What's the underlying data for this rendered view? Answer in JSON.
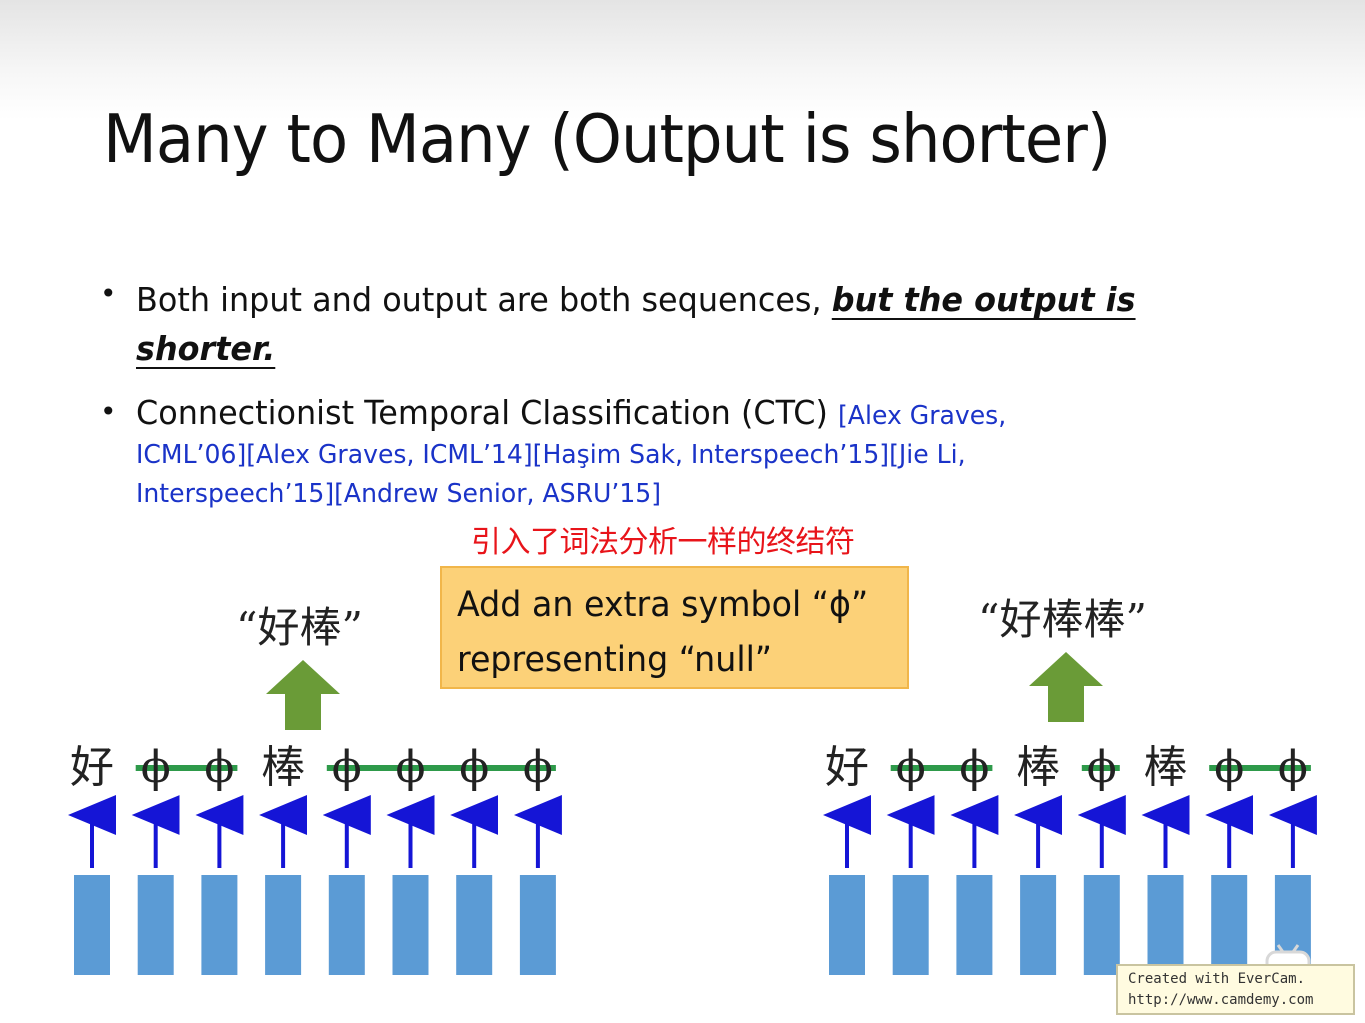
{
  "slide": {
    "title": "Many to Many (Output is shorter)",
    "bullets": [
      {
        "text_plain": "Both input and output are both sequences, ",
        "text_emphasis": "but the output is shorter."
      },
      {
        "text_plain": "Connectionist Temporal Classification (CTC) ",
        "refs_lines": [
          "[Alex Graves,",
          "ICML’06][Alex Graves, ICML’14][Haşim Sak, Interspeech’15][Jie Li,",
          "Interspeech’15][Andrew Senior, ASRU’15]"
        ]
      }
    ],
    "annotation": "引入了词法分析一样的终结符",
    "callout": {
      "line1": "Add an extra symbol “ϕ”",
      "line2": "representing “null”"
    },
    "left_example": {
      "output": "“好棒”",
      "tokens": [
        "好",
        "ϕ",
        "ϕ",
        "棒",
        "ϕ",
        "ϕ",
        "ϕ",
        "ϕ"
      ],
      "struck": [
        false,
        true,
        true,
        false,
        true,
        true,
        true,
        true
      ]
    },
    "right_example": {
      "output": "“好棒棒”",
      "tokens": [
        "好",
        "ϕ",
        "ϕ",
        "棒",
        "ϕ",
        "棒",
        "ϕ",
        "ϕ"
      ],
      "struck": [
        false,
        true,
        true,
        false,
        true,
        false,
        true,
        true
      ]
    },
    "watermark": {
      "line1": "Created with EverCam.",
      "line2": "http://www.camdemy.com"
    }
  },
  "colors": {
    "bar": "#5b9bd5",
    "arrow": "#1515d6",
    "strike": "#2e9a4a",
    "big_arrow": "#6a9b37",
    "callout_bg": "#fcd178",
    "refs": "#1a33c8",
    "annotation": "#e8141a"
  }
}
